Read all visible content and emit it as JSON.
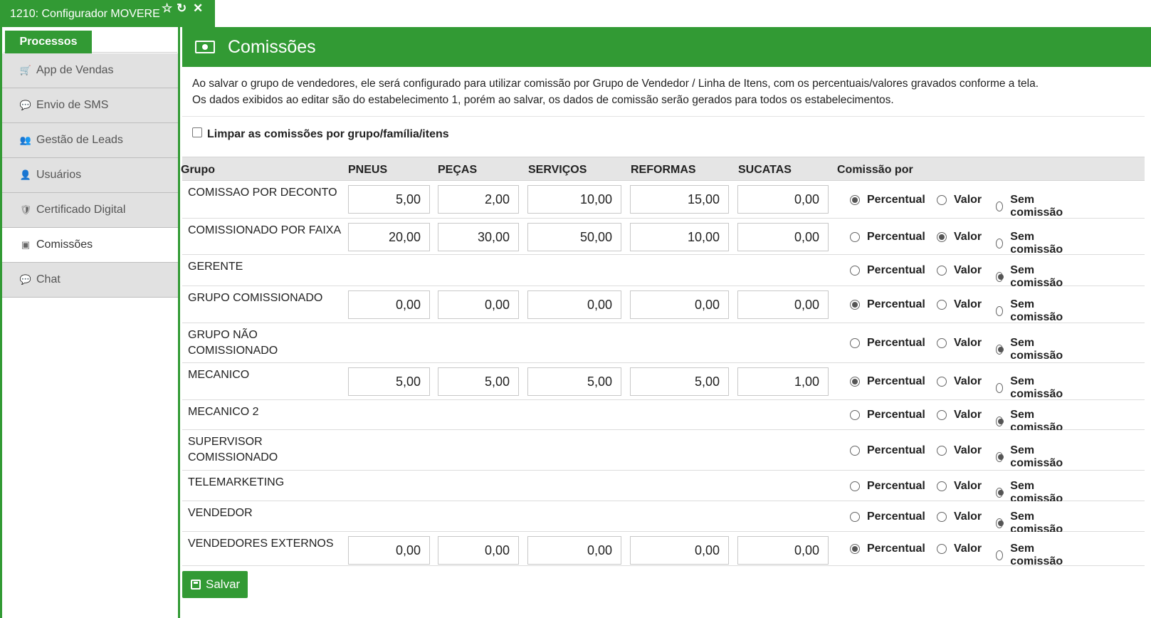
{
  "window": {
    "title": "1210: Configurador MOVERE"
  },
  "sidebar": {
    "section_button": "Processos",
    "items": [
      {
        "label": "App de Vendas",
        "icon": "shopping-cart-icon",
        "active": false
      },
      {
        "label": "Envio de SMS",
        "icon": "comment-icon",
        "active": false
      },
      {
        "label": "Gestão de Leads",
        "icon": "users-icon",
        "active": false
      },
      {
        "label": "Usuários",
        "icon": "user-icon",
        "active": false
      },
      {
        "label": "Certificado Digital",
        "icon": "shield-icon",
        "active": false
      },
      {
        "label": "Comissões",
        "icon": "money-icon",
        "active": true
      },
      {
        "label": "Chat",
        "icon": "wechat-icon",
        "active": false
      }
    ]
  },
  "header": {
    "title": "Comissões",
    "icon": "money-icon"
  },
  "info": {
    "line1": "Ao salvar o grupo de vendedores, ele será configurado para utilizar comissão por Grupo de Vendedor / Linha de Itens, com os percentuais/valores gravados conforme a tela.",
    "line2": "Os dados exibidos ao editar são do estabelecimento 1, porém ao salvar, os dados de comissão serão gerados para todos os estabelecimentos."
  },
  "clear_checkbox": {
    "label": "Limpar as comissões por grupo/família/itens",
    "checked": false
  },
  "table": {
    "headers": [
      "Grupo",
      "PNEUS",
      "PEÇAS",
      "SERVIÇOS",
      "REFORMAS",
      "SUCATAS",
      "Comissão por"
    ],
    "radio_labels": [
      "Percentual",
      "Valor",
      "Sem comissão"
    ],
    "rows": [
      {
        "grupo": "COMISSAO POR DECONTO",
        "values": [
          "5,00",
          "2,00",
          "10,00",
          "15,00",
          "0,00"
        ],
        "selected": 0
      },
      {
        "grupo": "COMISSIONADO POR FAIXA",
        "values": [
          "20,00",
          "30,00",
          "50,00",
          "10,00",
          "0,00"
        ],
        "selected": 1
      },
      {
        "grupo": "GERENTE",
        "values": null,
        "selected": 2
      },
      {
        "grupo": "GRUPO COMISSIONADO",
        "values": [
          "0,00",
          "0,00",
          "0,00",
          "0,00",
          "0,00"
        ],
        "selected": 0
      },
      {
        "grupo": "GRUPO NÃO COMISSIONADO",
        "values": null,
        "selected": 2
      },
      {
        "grupo": "MECANICO",
        "values": [
          "5,00",
          "5,00",
          "5,00",
          "5,00",
          "1,00"
        ],
        "selected": 0
      },
      {
        "grupo": "MECANICO 2",
        "values": null,
        "selected": 2
      },
      {
        "grupo": "SUPERVISOR COMISSIONADO",
        "values": null,
        "selected": 2
      },
      {
        "grupo": "TELEMARKETING",
        "values": null,
        "selected": 2
      },
      {
        "grupo": "VENDEDOR",
        "values": null,
        "selected": 2
      },
      {
        "grupo": "VENDEDORES EXTERNOS",
        "values": [
          "0,00",
          "0,00",
          "0,00",
          "0,00",
          "0,00"
        ],
        "selected": 0
      }
    ]
  },
  "save_button": {
    "label": "Salvar"
  },
  "colors": {
    "brand_green": "#329a34"
  }
}
